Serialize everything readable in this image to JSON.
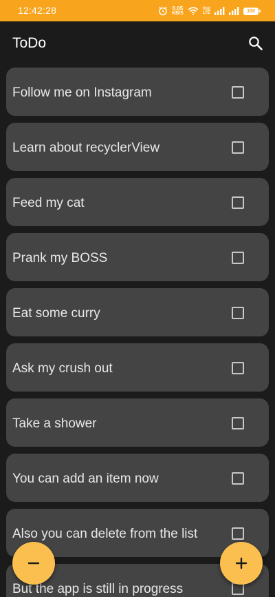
{
  "status_bar": {
    "time": "12:42:28",
    "net_speed_value": "0.05",
    "net_speed_unit": "KB/S",
    "volte_top": "Vo))",
    "volte_bottom": "LTE",
    "battery": "100"
  },
  "app_bar": {
    "title": "ToDo",
    "search_icon": "search-icon"
  },
  "todos": [
    {
      "text": "Follow me on Instagram",
      "checked": false
    },
    {
      "text": "Learn about recyclerView",
      "checked": false
    },
    {
      "text": "Feed my cat",
      "checked": false
    },
    {
      "text": "Prank my BOSS",
      "checked": false
    },
    {
      "text": "Eat some curry",
      "checked": false
    },
    {
      "text": "Ask my crush out",
      "checked": false
    },
    {
      "text": "Take a shower",
      "checked": false
    },
    {
      "text": "You can add an item now",
      "checked": false
    },
    {
      "text": "Also you can delete from the list",
      "checked": false
    },
    {
      "text": "But the app is still in progress",
      "checked": false
    }
  ],
  "fabs": {
    "remove_icon": "minus-icon",
    "add_icon": "plus-icon"
  },
  "colors": {
    "status_bar": "#f8a41c",
    "background": "#1b1b1b",
    "card": "#444444",
    "fab": "#fbbf4f"
  }
}
